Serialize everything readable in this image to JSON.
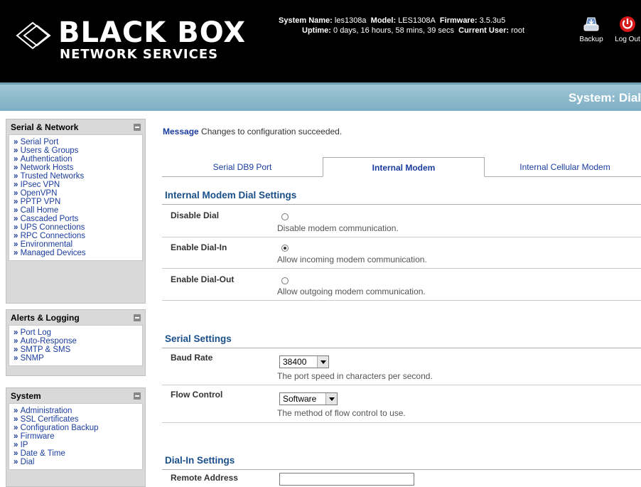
{
  "header": {
    "logo_main": "BLACK BOX",
    "logo_sub": "NETWORK SERVICES",
    "system_name_label": "System Name:",
    "system_name": "les1308a",
    "model_label": "Model:",
    "model": "LES1308A",
    "firmware_label": "Firmware:",
    "firmware": "3.5.3u5",
    "uptime_label": "Uptime:",
    "uptime": "0 days, 16 hours, 58 mins, 39 secs",
    "user_label": "Current User:",
    "user": "root",
    "backup_label": "Backup",
    "logout_label": "Log Out"
  },
  "banner": {
    "title": "System: Dial"
  },
  "sidebar": {
    "serial_network": {
      "title": "Serial & Network",
      "items": [
        "Serial Port",
        "Users & Groups",
        "Authentication",
        "Network Hosts",
        "Trusted Networks",
        "IPsec VPN",
        "OpenVPN",
        "PPTP VPN",
        "Call Home",
        "Cascaded Ports",
        "UPS Connections",
        "RPC Connections",
        "Environmental",
        "Managed Devices"
      ]
    },
    "alerts": {
      "title": "Alerts & Logging",
      "items": [
        "Port Log",
        "Auto-Response",
        "SMTP & SMS",
        "SNMP"
      ]
    },
    "system": {
      "title": "System",
      "items": [
        "Administration",
        "SSL Certificates",
        "Configuration Backup",
        "Firmware",
        "IP",
        "Date & Time",
        "Dial"
      ]
    }
  },
  "message": {
    "keyword": "Message",
    "text": "Changes to configuration succeeded."
  },
  "tabs": [
    "Serial DB9 Port",
    "Internal Modem",
    "Internal Cellular Modem"
  ],
  "modem_dial": {
    "heading": "Internal Modem Dial Settings",
    "options": [
      {
        "label": "Disable Dial",
        "desc": "Disable modem communication.",
        "selected": false
      },
      {
        "label": "Enable Dial-In",
        "desc": "Allow incoming modem communication.",
        "selected": true
      },
      {
        "label": "Enable Dial-Out",
        "desc": "Allow outgoing modem communication.",
        "selected": false
      }
    ]
  },
  "serial_settings": {
    "heading": "Serial Settings",
    "baud_label": "Baud Rate",
    "baud_value": "38400",
    "baud_desc": "The port speed in characters per second.",
    "flow_label": "Flow Control",
    "flow_value": "Software",
    "flow_desc": "The method of flow control to use."
  },
  "dialin_settings": {
    "heading": "Dial-In Settings",
    "remote_label": "Remote Address",
    "remote_value": ""
  },
  "colors": {
    "header_bg": "#000000",
    "banner": "#8fbbcc",
    "link": "#1a3c9e",
    "heading": "#1a4f8a"
  }
}
